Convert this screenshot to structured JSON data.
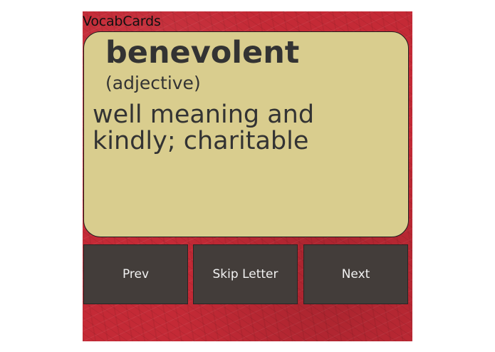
{
  "app": {
    "title": "VocabCards"
  },
  "card": {
    "word": "benevolent",
    "part_of_speech": "(adjective)",
    "definition": "well meaning and kindly; charitable"
  },
  "buttons": {
    "prev_label": "Prev",
    "skip_label": "Skip Letter",
    "next_label": "Next"
  },
  "colors": {
    "background": "#c42a36",
    "card": "#d9cd8e",
    "button": "#433d3a",
    "button_text": "#f2f2f2",
    "card_text": "#333333"
  }
}
